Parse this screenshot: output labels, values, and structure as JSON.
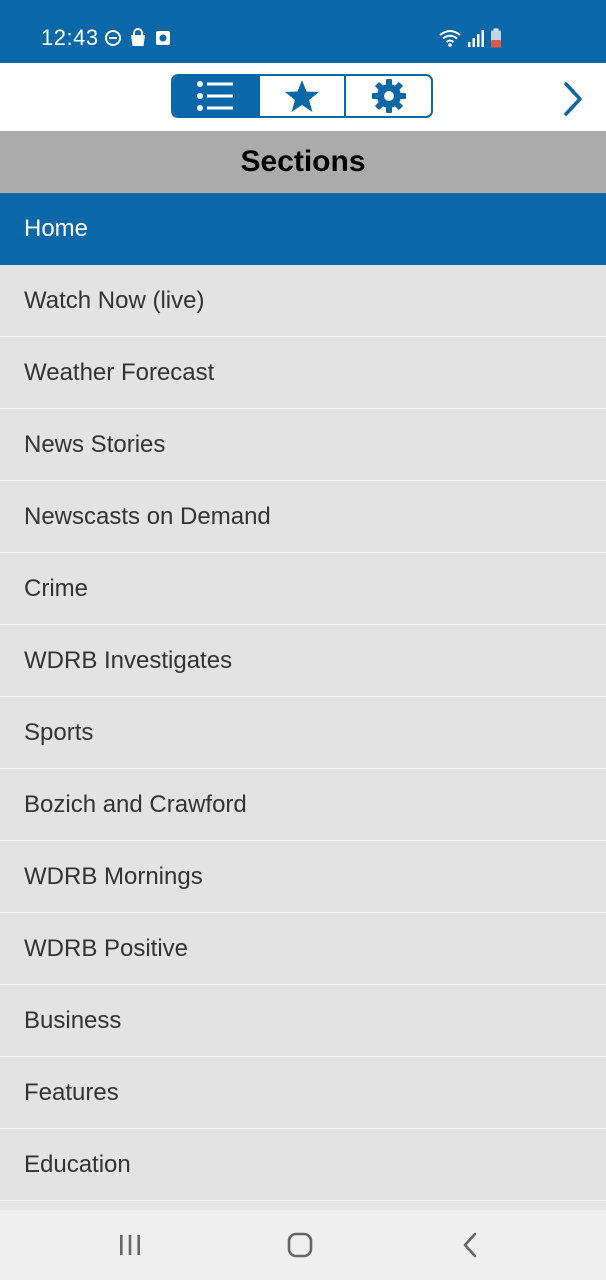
{
  "status_bar": {
    "time": "12:43",
    "left_icons": [
      "do-not-disturb-icon",
      "shopping-bag-icon",
      "camera-app-icon"
    ],
    "right_icons": [
      "wifi-icon",
      "signal-icon",
      "battery-low-icon"
    ]
  },
  "toolbar": {
    "tabs": [
      {
        "icon": "list-icon",
        "active": true
      },
      {
        "icon": "star-icon",
        "active": false
      },
      {
        "icon": "gear-icon",
        "active": false
      }
    ],
    "next_icon": "chevron-right-icon"
  },
  "header": {
    "title": "Sections"
  },
  "sections": [
    {
      "label": "Home",
      "active": true
    },
    {
      "label": "Watch Now (live)"
    },
    {
      "label": "Weather Forecast"
    },
    {
      "label": "News Stories"
    },
    {
      "label": "Newscasts on Demand"
    },
    {
      "label": "Crime"
    },
    {
      "label": "WDRB Investigates"
    },
    {
      "label": "Sports"
    },
    {
      "label": "Bozich and Crawford"
    },
    {
      "label": "WDRB Mornings"
    },
    {
      "label": "WDRB Positive"
    },
    {
      "label": "Business"
    },
    {
      "label": "Features"
    },
    {
      "label": "Education"
    }
  ],
  "nav_bar": {
    "buttons": [
      "recent-apps-icon",
      "home-icon",
      "back-icon"
    ]
  },
  "colors": {
    "accent": "#0b68a8",
    "header_bg": "#ababab",
    "list_bg": "#e3e3e3"
  }
}
